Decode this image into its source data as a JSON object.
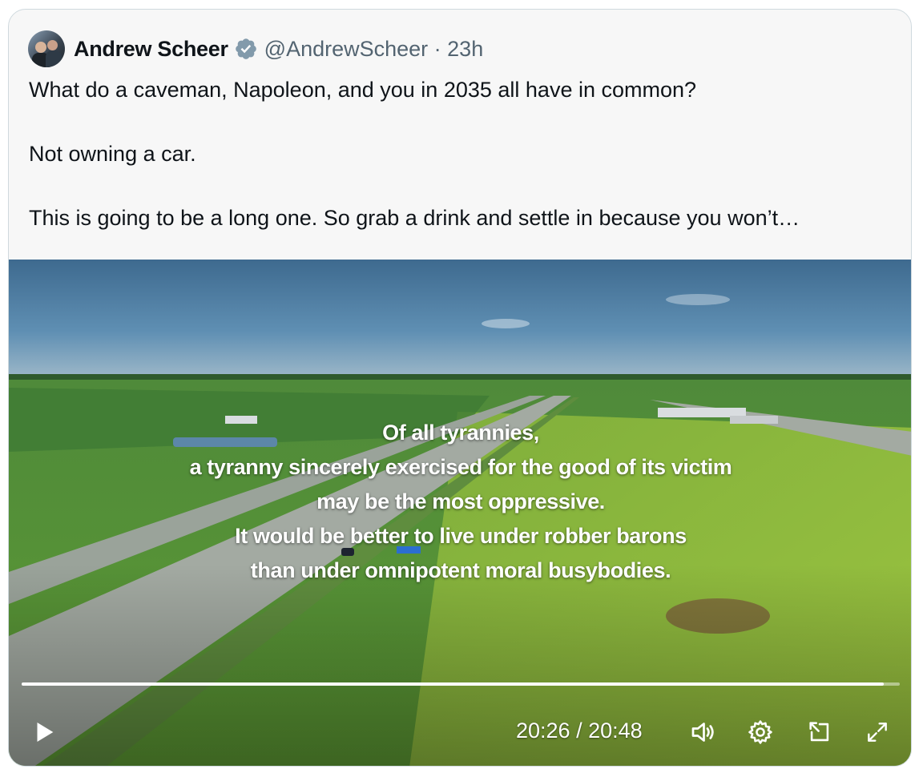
{
  "tweet": {
    "author_name": "Andrew Scheer",
    "handle_time": "@AndrewScheer · 23h",
    "text": "What do a caveman, Napoleon, and you in 2035 all have in common?\n\nNot owning a car.\n\nThis is going to be a long one. So grab a drink and settle in because you won’t…",
    "verified_icon": "verified-badge-icon"
  },
  "video": {
    "caption_lines": [
      "Of all tyrannies,",
      "a tyranny sincerely exercised for the good of its victim",
      "may be the most oppressive.",
      "It would be better to live under robber barons",
      "than under omnipotent  moral busybodies."
    ],
    "time": "20:26 / 20:48",
    "progress": 0.982,
    "icons": [
      "play-icon",
      "volume-icon",
      "settings-gear-icon",
      "pop-out-icon",
      "fullscreen-icon"
    ]
  },
  "colors": {
    "verified": "#829aab",
    "handle": "#536471",
    "card_bg": "#f7f7f7",
    "border": "#cfd9de"
  }
}
